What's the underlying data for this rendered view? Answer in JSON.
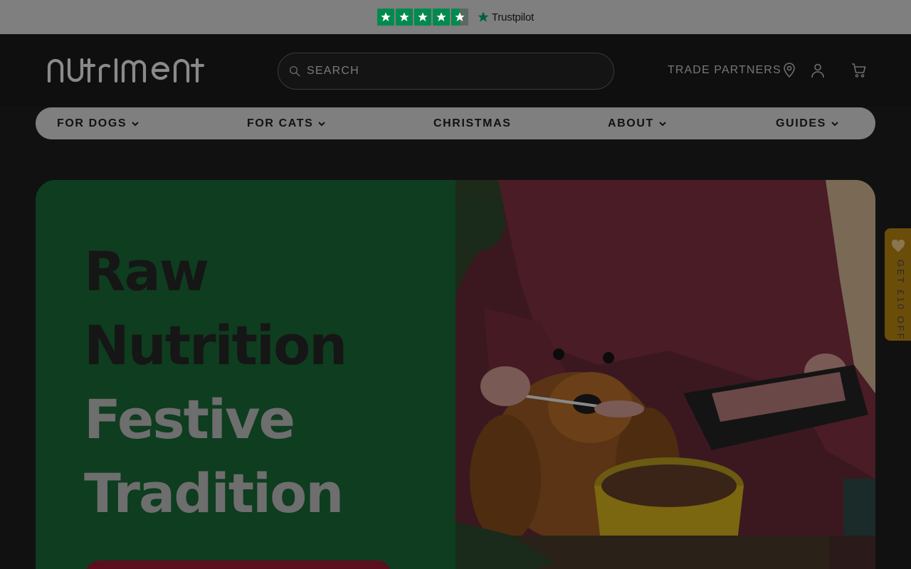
{
  "trustpilot": {
    "stars": 4.5,
    "brand": "Trustpilot",
    "star_color": "#008a4f"
  },
  "header": {
    "logo_text": "nutriment",
    "search_placeholder": "SEARCH",
    "trade_partners": "TRADE PARTNERS",
    "icons": [
      "location-pin-icon",
      "user-icon",
      "cart-icon"
    ]
  },
  "nav": {
    "items": [
      {
        "label": "FOR DOGS",
        "has_dropdown": true
      },
      {
        "label": "FOR CATS",
        "has_dropdown": true
      },
      {
        "label": "CHRISTMAS",
        "has_dropdown": false
      },
      {
        "label": "ABOUT",
        "has_dropdown": true
      },
      {
        "label": "GUIDES",
        "has_dropdown": true
      }
    ]
  },
  "hero": {
    "title_lines": [
      "Raw",
      "Nutrition",
      "Festive",
      "Tradition"
    ],
    "panel_color": "#0e3d1f",
    "cta_color": "#5a0f1e"
  },
  "side_tab": {
    "label": "GET £10 OFF",
    "icon": "heart-icon",
    "color": "#6b4d0a"
  }
}
